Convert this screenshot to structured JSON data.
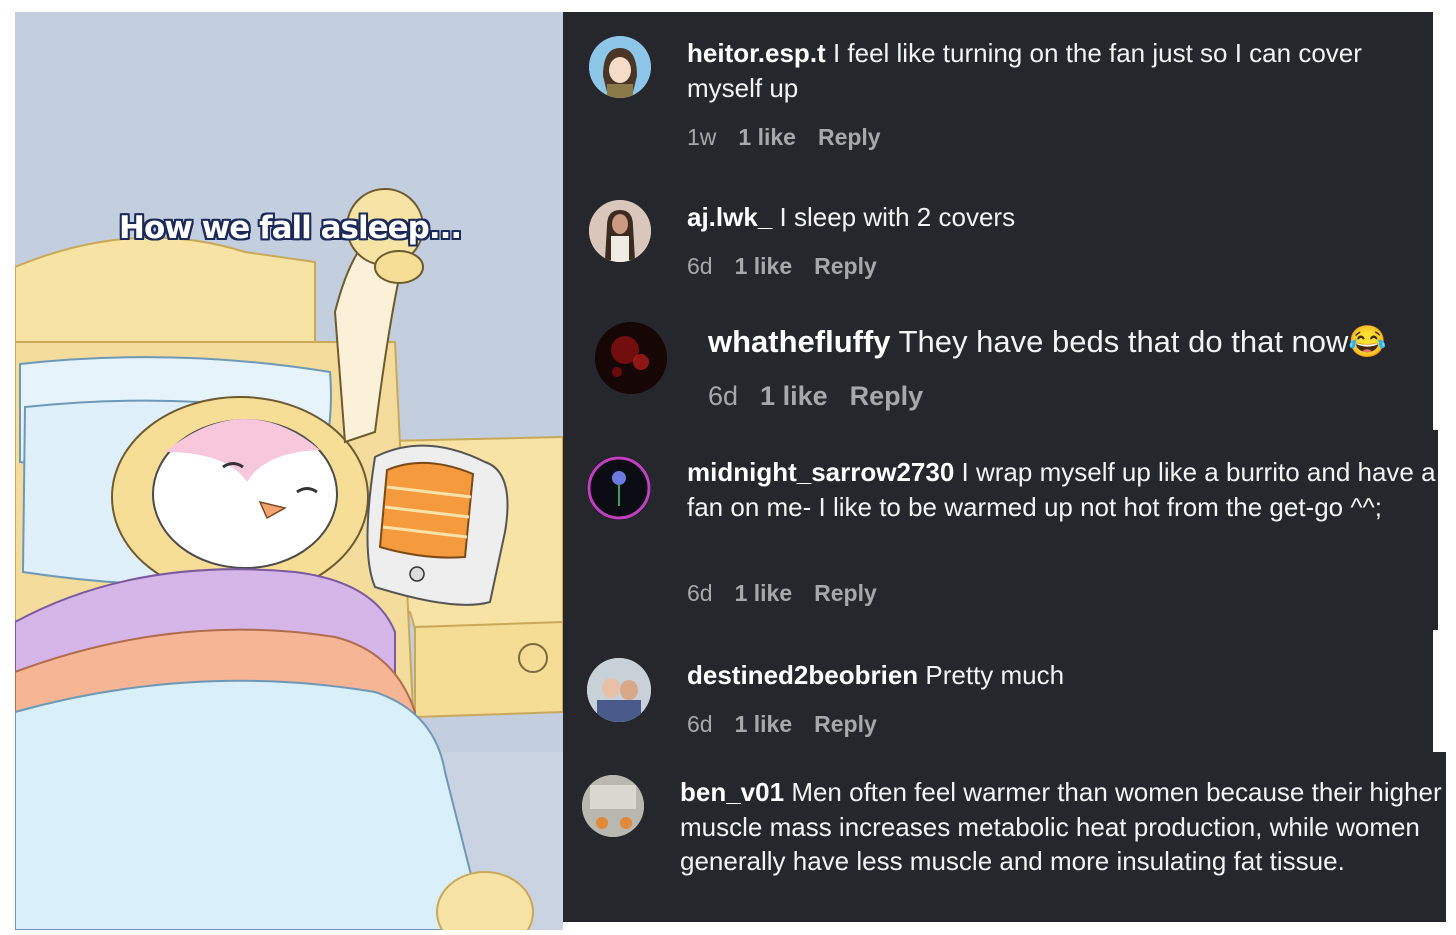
{
  "video": {
    "caption": "How we fall asleep..."
  },
  "comments": [
    {
      "username": "heitor.esp.t",
      "text": "I feel like turning on the fan just so I can cover myself up",
      "age": "1w",
      "likes": "1 like",
      "reply": "Reply"
    },
    {
      "username": "aj.lwk_",
      "text": "I sleep with 2 covers",
      "age": "6d",
      "likes": "1 like",
      "reply": "Reply"
    },
    {
      "username": "whathefluffy",
      "text": "They have beds that do that now😂",
      "age": "6d",
      "likes": "1 like",
      "reply": "Reply"
    },
    {
      "username": "midnight_sarrow2730",
      "text": "I wrap myself up like a burrito and have a fan on me- I like to be warmed up not hot from the get-go ^^;",
      "age": "6d",
      "likes": "1 like",
      "reply": "Reply"
    },
    {
      "username": "destined2beobrien",
      "text": "Pretty much",
      "age": "6d",
      "likes": "1 like",
      "reply": "Reply"
    },
    {
      "username": "ben_v01",
      "text": "Men often feel warmer than women because their higher muscle mass increases metabolic heat production, while women generally have less muscle and more insulating fat tissue."
    }
  ],
  "colors": {
    "panel_bg": "#26272c",
    "meta_text": "#a7a8ab",
    "illustration_bg": "#c3cedf"
  }
}
